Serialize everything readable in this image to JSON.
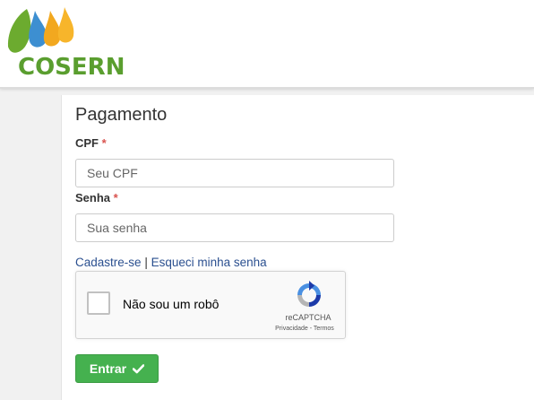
{
  "brand": {
    "name": "COSERN"
  },
  "form": {
    "title": "Pagamento",
    "cpf": {
      "label": "CPF",
      "required_mark": "*",
      "placeholder": "Seu CPF"
    },
    "password": {
      "label": "Senha",
      "required_mark": "*",
      "placeholder": "Sua senha"
    },
    "links": {
      "register": "Cadastre-se",
      "separator": "|",
      "forgot": "Esqueci minha senha"
    },
    "submit_label": "Entrar",
    "submit_icon": "check-icon"
  },
  "captcha": {
    "label": "Não sou um robô",
    "brand": "reCAPTCHA",
    "privacy": "Privacidade",
    "terms_sep": " - ",
    "terms": "Termos"
  },
  "colors": {
    "brand_green": "#5a9e2f",
    "button_green": "#45b14f",
    "required_red": "#d9534f",
    "link_blue": "#2a4f8f"
  }
}
